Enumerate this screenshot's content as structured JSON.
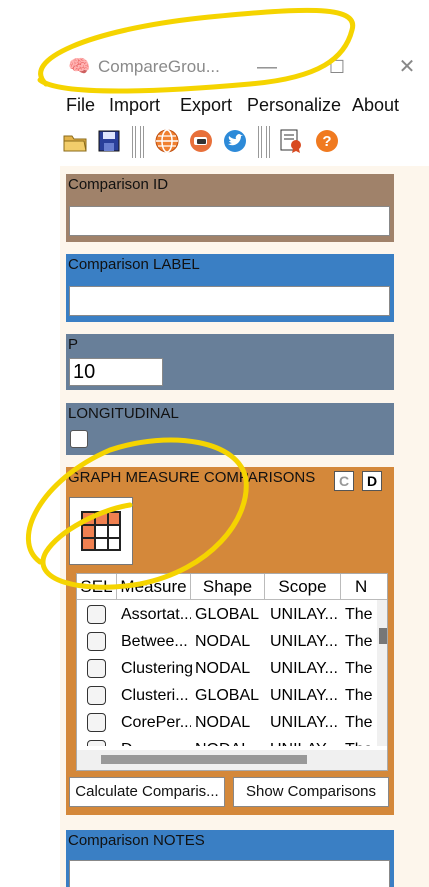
{
  "window": {
    "title": "CompareGrou...",
    "app_icon": "brain-icon",
    "minimize": "—",
    "maximize": "☐",
    "close": "✕"
  },
  "menu": [
    "File",
    "Import",
    "Export",
    "Personalize",
    "About"
  ],
  "toolbar": [
    "open-folder-icon",
    "save-icon",
    "web-icon",
    "forum-icon",
    "twitter-icon",
    "report-icon",
    "help-icon"
  ],
  "comparison_id": {
    "label": "Comparison ID",
    "value": ""
  },
  "comparison_label": {
    "label": "Comparison LABEL",
    "value": ""
  },
  "p": {
    "label": "P",
    "value": "10"
  },
  "longitudinal": {
    "label": "LONGITUDINAL",
    "checked": false
  },
  "graph_measure": {
    "label": "GRAPH MEASURE COMPARISONS",
    "c_label": "C",
    "d_label": "D",
    "headers": [
      "SEL",
      "Measure",
      "Shape",
      "Scope",
      "N"
    ],
    "rows": [
      {
        "measure": "Assortat...",
        "shape": "GLOBAL",
        "scope": "UNILAY...",
        "n": "The"
      },
      {
        "measure": "Betwee...",
        "shape": "NODAL",
        "scope": "UNILAY...",
        "n": "The"
      },
      {
        "measure": "Clustering",
        "shape": "NODAL",
        "scope": "UNILAY...",
        "n": "The"
      },
      {
        "measure": "Clusteri...",
        "shape": "GLOBAL",
        "scope": "UNILAY...",
        "n": "The"
      },
      {
        "measure": "CorePer...",
        "shape": "NODAL",
        "scope": "UNILAY...",
        "n": "The"
      },
      {
        "measure": "D...",
        "shape": "NODAL",
        "scope": "UNILAY...",
        "n": "The"
      }
    ],
    "calc_button": "Calculate Comparis...",
    "show_button": "Show Comparisons"
  },
  "comparison_notes": {
    "label": "Comparison NOTES"
  },
  "colors": {
    "brown_panel": "#a0826a",
    "blue_panel": "#3a7fc4",
    "slate_panel": "#687f99",
    "orange_panel": "#d4883a",
    "annotation": "#f5d400"
  }
}
